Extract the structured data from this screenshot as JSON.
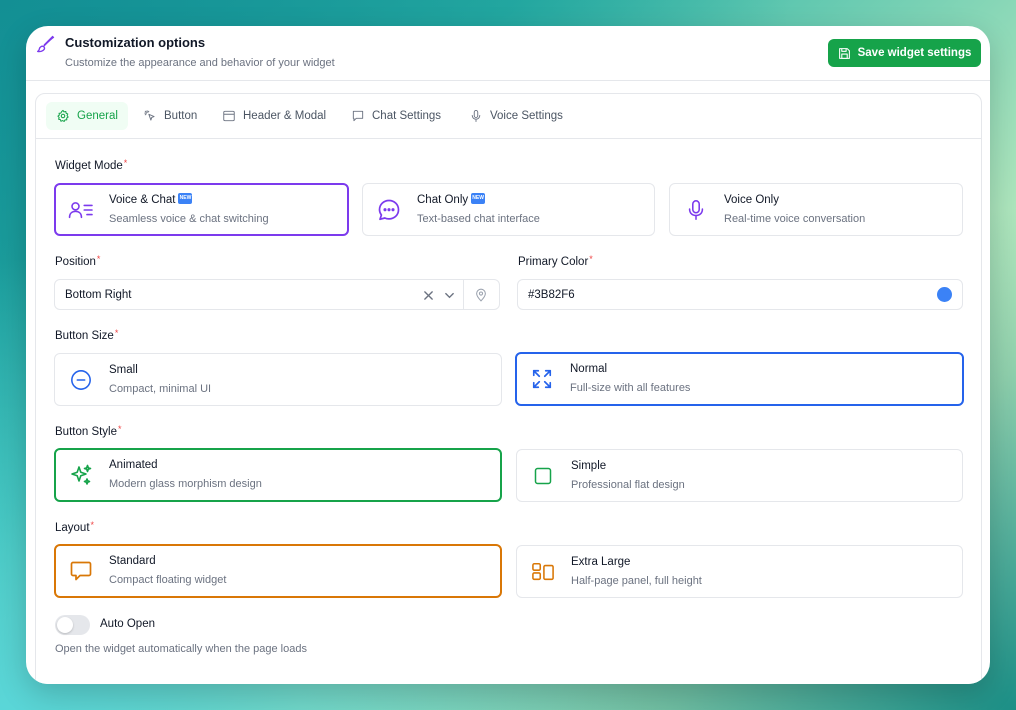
{
  "header": {
    "title": "Customization options",
    "subtitle": "Customize the appearance and behavior of your widget",
    "save_label": "Save widget settings",
    "icon": "paintbrush-icon"
  },
  "tabs": [
    {
      "label": "General",
      "icon": "gear-icon",
      "active": true
    },
    {
      "label": "Button",
      "icon": "pointer-click-icon",
      "active": false
    },
    {
      "label": "Header & Modal",
      "icon": "window-icon",
      "active": false
    },
    {
      "label": "Chat Settings",
      "icon": "chat-bubble-icon",
      "active": false
    },
    {
      "label": "Voice Settings",
      "icon": "microphone-icon",
      "active": false
    }
  ],
  "widget_mode": {
    "label": "Widget Mode",
    "options": [
      {
        "title": "Voice & Chat",
        "badge": "NEW",
        "desc": "Seamless voice & chat switching",
        "icon": "user-list-icon",
        "selected": true
      },
      {
        "title": "Chat Only",
        "badge": "NEW",
        "desc": "Text-based chat interface",
        "icon": "chat-dots-icon",
        "selected": false
      },
      {
        "title": "Voice Only",
        "desc": "Real-time voice conversation",
        "icon": "microphone-icon",
        "selected": false
      }
    ]
  },
  "position": {
    "label": "Position",
    "value": "Bottom Right"
  },
  "primary_color": {
    "label": "Primary Color",
    "value": "#3B82F6",
    "swatch": "#3B82F6"
  },
  "button_size": {
    "label": "Button Size",
    "options": [
      {
        "title": "Small",
        "desc": "Compact, minimal UI",
        "icon": "minus-circle-icon",
        "selected": false
      },
      {
        "title": "Normal",
        "desc": "Full-size with all features",
        "icon": "expand-icon",
        "selected": true
      }
    ]
  },
  "button_style": {
    "label": "Button Style",
    "options": [
      {
        "title": "Animated",
        "desc": "Modern glass morphism design",
        "icon": "sparkles-icon",
        "selected": true
      },
      {
        "title": "Simple",
        "desc": "Professional flat design",
        "icon": "square-icon",
        "selected": false
      }
    ]
  },
  "layout": {
    "label": "Layout",
    "options": [
      {
        "title": "Standard",
        "desc": "Compact floating widget",
        "icon": "chat-bubble-icon",
        "selected": true
      },
      {
        "title": "Extra Large",
        "desc": "Half-page panel, full height",
        "icon": "layout-panels-icon",
        "selected": false
      }
    ]
  },
  "auto_open": {
    "label": "Auto Open",
    "desc": "Open the widget automatically when the page loads",
    "enabled": false
  },
  "colors": {
    "green": "#16a34a",
    "purple": "#7c3aed",
    "blue": "#2563eb",
    "orange": "#d97706"
  }
}
